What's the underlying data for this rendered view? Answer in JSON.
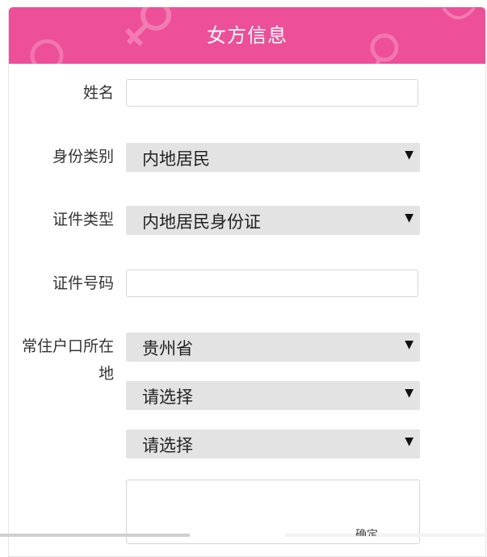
{
  "header": {
    "title": "女方信息",
    "background_color": "#ee4f99"
  },
  "form": {
    "name": {
      "label": "姓名",
      "value": ""
    },
    "identity_category": {
      "label": "身份类别",
      "selected": "内地居民"
    },
    "id_type": {
      "label": "证件类型",
      "selected": "内地居民身份证"
    },
    "id_number": {
      "label": "证件号码",
      "value": ""
    },
    "residence": {
      "label": "常住户口所在地",
      "province": "贵州省",
      "city": "请选择",
      "district": "请选择",
      "detail_value": ""
    }
  },
  "icons": {
    "dropdown_arrow": "▼"
  },
  "bottom": {
    "partial_text": "确定"
  }
}
